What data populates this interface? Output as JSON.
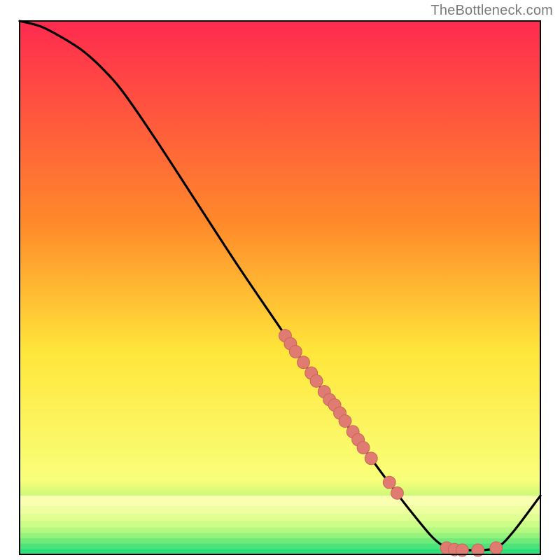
{
  "attribution": "TheBottleneck.com",
  "colors": {
    "gradient_top": "#ff2a4f",
    "gradient_mid1": "#ff8a2a",
    "gradient_mid2": "#ffe63a",
    "gradient_mid3": "#f9ff7a",
    "gradient_bottom": "#2fe07a",
    "curve": "#000000",
    "marker_fill": "#e07b72",
    "marker_stroke": "#c9645b",
    "frame": "#000000",
    "background": "#ffffff"
  },
  "chart_data": {
    "type": "line",
    "title": "",
    "xlabel": "",
    "ylabel": "",
    "xlim": [
      0,
      100
    ],
    "ylim": [
      0,
      100
    ],
    "curve": [
      {
        "x": 0,
        "y": 100
      },
      {
        "x": 4,
        "y": 99
      },
      {
        "x": 8,
        "y": 97
      },
      {
        "x": 12,
        "y": 94.5
      },
      {
        "x": 16,
        "y": 91
      },
      {
        "x": 20,
        "y": 86.5
      },
      {
        "x": 26,
        "y": 78
      },
      {
        "x": 34,
        "y": 66
      },
      {
        "x": 42,
        "y": 54
      },
      {
        "x": 50,
        "y": 42.5
      },
      {
        "x": 58,
        "y": 31
      },
      {
        "x": 66,
        "y": 20
      },
      {
        "x": 72,
        "y": 12
      },
      {
        "x": 76,
        "y": 7
      },
      {
        "x": 79,
        "y": 3.5
      },
      {
        "x": 81,
        "y": 1.8
      },
      {
        "x": 83,
        "y": 0.9
      },
      {
        "x": 86,
        "y": 0.8
      },
      {
        "x": 89,
        "y": 0.8
      },
      {
        "x": 92,
        "y": 1.5
      },
      {
        "x": 95,
        "y": 4.5
      },
      {
        "x": 100,
        "y": 11
      }
    ],
    "markers": [
      {
        "x": 51,
        "y": 41
      },
      {
        "x": 52,
        "y": 39.5
      },
      {
        "x": 53,
        "y": 38
      },
      {
        "x": 54.5,
        "y": 36
      },
      {
        "x": 56,
        "y": 34
      },
      {
        "x": 57,
        "y": 32.5
      },
      {
        "x": 58.5,
        "y": 30.5
      },
      {
        "x": 59.5,
        "y": 29
      },
      {
        "x": 60.5,
        "y": 28
      },
      {
        "x": 61.5,
        "y": 26.5
      },
      {
        "x": 62.5,
        "y": 25
      },
      {
        "x": 64,
        "y": 23
      },
      {
        "x": 65,
        "y": 21.5
      },
      {
        "x": 66,
        "y": 20
      },
      {
        "x": 67.5,
        "y": 18
      },
      {
        "x": 71,
        "y": 13.5
      },
      {
        "x": 72.5,
        "y": 11.5
      },
      {
        "x": 82,
        "y": 1.2
      },
      {
        "x": 83.5,
        "y": 0.9
      },
      {
        "x": 85,
        "y": 0.8
      },
      {
        "x": 88,
        "y": 0.8
      },
      {
        "x": 91.5,
        "y": 1.2
      }
    ],
    "bottom_bands": [
      {
        "y0": 9.0,
        "y1": 11.0,
        "color": "#f8ffb0"
      },
      {
        "y0": 7.5,
        "y1": 9.0,
        "color": "#eeffa0"
      },
      {
        "y0": 6.2,
        "y1": 7.5,
        "color": "#dfff92"
      },
      {
        "y0": 5.0,
        "y1": 6.2,
        "color": "#ccfd88"
      },
      {
        "y0": 4.0,
        "y1": 5.0,
        "color": "#b4f880"
      },
      {
        "y0": 3.0,
        "y1": 4.0,
        "color": "#95f27c"
      },
      {
        "y0": 2.0,
        "y1": 3.0,
        "color": "#70eb7a"
      },
      {
        "y0": 1.0,
        "y1": 2.0,
        "color": "#4be47a"
      },
      {
        "y0": 0.0,
        "y1": 1.0,
        "color": "#2fe07a"
      }
    ],
    "marker_radius_pct": 1.2
  }
}
